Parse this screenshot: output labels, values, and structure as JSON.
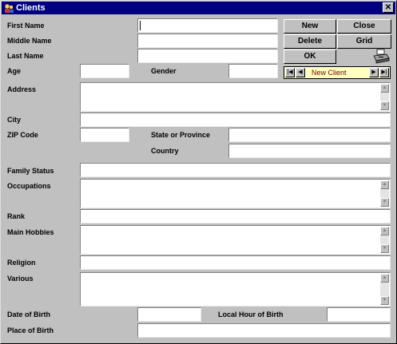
{
  "window": {
    "title": "Clients",
    "close_glyph": "✕"
  },
  "labels": {
    "first_name": "First Name",
    "middle_name": "Middle Name",
    "last_name": "Last Name",
    "age": "Age",
    "gender": "Gender",
    "address": "Address",
    "city": "City",
    "zip": "ZIP Code",
    "state": "State or Province",
    "country": "Country",
    "family_status": "Family Status",
    "occupations": "Occupations",
    "rank": "Rank",
    "main_hobbies": "Main Hobbies",
    "religion": "Religion",
    "various": "Various",
    "date_of_birth": "Date of Birth",
    "local_hour_of_birth": "Local Hour of Birth",
    "place_of_birth": "Place of Birth"
  },
  "buttons": {
    "new": "New",
    "close": "Close",
    "delete": "Delete",
    "grid": "Grid",
    "ok": "OK"
  },
  "navigator": {
    "record_text": "New Client",
    "first": "|◀",
    "prev": "◀",
    "next": "▶",
    "last": "▶|"
  },
  "fields": {
    "first_name": "",
    "middle_name": "",
    "last_name": "",
    "age": "",
    "gender": "",
    "address": "",
    "city": "",
    "zip": "",
    "state": "",
    "country": "",
    "family_status": "",
    "occupations": "",
    "rank": "",
    "main_hobbies": "",
    "religion": "",
    "various": "",
    "date_of_birth": "",
    "local_hour_of_birth": "",
    "place_of_birth": ""
  },
  "icons": {
    "app": "clients-app-icon",
    "printer": "printer-icon"
  },
  "colors": {
    "titlebar": "#000080",
    "window": "#c0c0c0",
    "navigator_bg": "#ffffc0",
    "navigator_text": "#800000"
  }
}
